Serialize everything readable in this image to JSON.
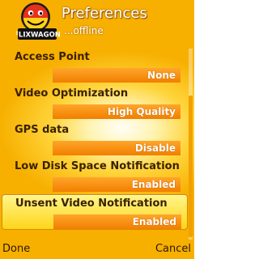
{
  "header": {
    "title": "Preferences",
    "subtitle": "...offline",
    "logo_text": "FLIXWAGON"
  },
  "settings": [
    {
      "label": "Access Point",
      "value": "None",
      "selected": false
    },
    {
      "label": "Video Optimization",
      "value": "High Quality",
      "selected": false
    },
    {
      "label": "GPS data",
      "value": "Disable",
      "selected": false
    },
    {
      "label": "Low Disk Space Notification",
      "value": "Enabled",
      "selected": false
    },
    {
      "label": "Unsent Video Notification",
      "value": "Enabled",
      "selected": true
    }
  ],
  "softkeys": {
    "left": "Done",
    "right": "Cancel"
  },
  "colors": {
    "background": "#ffd43a",
    "value_bar": "#f5900f",
    "selection": "#ffe84a",
    "label_text": "#3a2100"
  }
}
